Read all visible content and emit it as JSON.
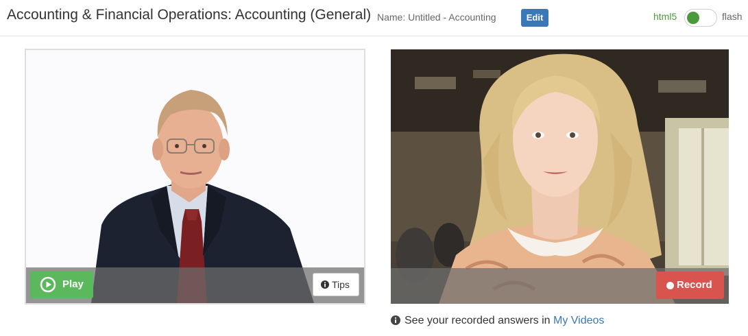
{
  "header": {
    "title": "Accounting & Financial Operations: Accounting (General)",
    "name_prefix": "Name:",
    "name_value": "Untitled - Accounting",
    "edit_label": "Edit",
    "toggle_left_label": "html5",
    "toggle_right_label": "flash",
    "toggle_state": "html5"
  },
  "interviewer_panel": {
    "play_label": "Play",
    "tips_label": "Tips"
  },
  "recorder_panel": {
    "record_label": "Record"
  },
  "footer": {
    "note_text": "See your recorded answers in",
    "link_text": "My Videos"
  },
  "colors": {
    "edit_button": "#3a78b8",
    "play_button": "#5cb85c",
    "record_button": "#d9534f",
    "toggle_accent": "#4a9a3b",
    "link": "#3a78b8"
  },
  "icons": [
    "play-circle-icon",
    "info-circle-icon",
    "record-dot-icon"
  ]
}
